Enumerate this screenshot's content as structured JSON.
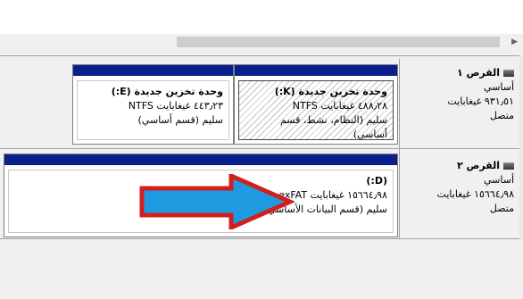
{
  "disk1": {
    "title": "القرص ١",
    "type": "أساسي",
    "size": "٩٣١٫٥١ غيغابايت",
    "status": "متصل",
    "partitions": [
      {
        "title": "وحدة تخزين جديدة  (K:)",
        "size_fs": "٤٨٨٫٢٨ غيغابايت NTFS",
        "status": "سليم (النظام، نشط، قسم أساسي)"
      },
      {
        "title": "وحدة تخزين جديدة  (E:)",
        "size_fs": "٤٤٣٫٢٣ غيغابايت NTFS",
        "status": "سليم (قسم أساسي)"
      }
    ]
  },
  "disk2": {
    "title": "القرص ٢",
    "type": "أساسي",
    "size": "١٥٦٦٤٫٩٨ غيغابايت",
    "status": "متصل",
    "partitions": [
      {
        "title": "(D:)",
        "size_fs": "١٥٦٦٤٫٩٨ غيغابايت exFAT",
        "status": "سليم (قسم البيانات الأساسي)"
      }
    ]
  },
  "icons": {
    "disk": "disk-drive-icon",
    "scroll_right": "scroll-right-arrow-icon",
    "annotation": "annotation-arrow-icon"
  },
  "colors": {
    "partition_bar": "#0a1e8c",
    "arrow_fill": "#1e9be0",
    "arrow_outline": "#d21e1e"
  }
}
